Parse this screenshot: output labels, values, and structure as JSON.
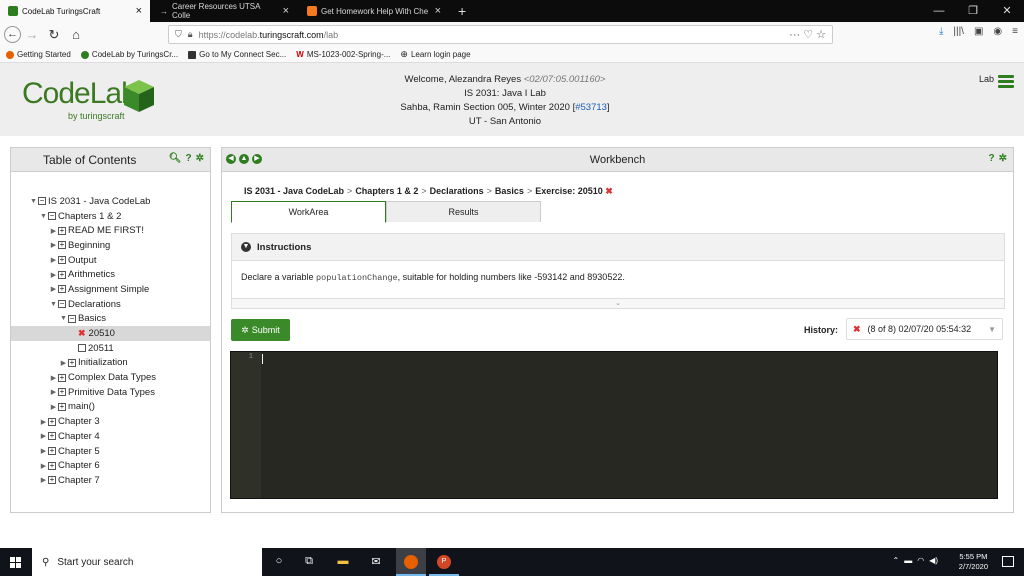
{
  "browser": {
    "tabs": [
      {
        "title": "CodeLab   TuringsCraft",
        "color": "#2e7d1e"
      },
      {
        "title": "Career Resources   UTSA Colle",
        "color": "#888888"
      },
      {
        "title": "Get Homework Help With Che",
        "color": "#f47b20"
      }
    ],
    "url_prefix": "https://codelab.",
    "url_domain": "turingscraft.com",
    "url_path": "/lab",
    "bookmarks": [
      "Getting Started",
      "CodeLab by TuringsCr...",
      "Go to My Connect Sec...",
      "MS-1023-002-Spring-...",
      "Learn login page"
    ]
  },
  "header": {
    "logo": "CodeLab",
    "logo_sub": "by turingscraft",
    "welcome": "Welcome, Alezandra Reyes",
    "welcome_id": "<02/07:05.001160>",
    "course": "IS 2031: Java I Lab",
    "section_prefix": "Sahba, Ramin  Section 005, Winter 2020  [",
    "section_id": "#53713",
    "section_suffix": "]",
    "school": "UT - San Antonio",
    "lab_link": "Lab"
  },
  "toc": {
    "title": "Table of Contents",
    "items": [
      {
        "label": "IS 2031 - Java CodeLab",
        "indent": 0,
        "tw": "▼",
        "box": "⊟"
      },
      {
        "label": "Chapters 1 & 2",
        "indent": 1,
        "tw": "▼",
        "box": "⊟"
      },
      {
        "label": "READ ME FIRST!",
        "indent": 2,
        "tw": "▶",
        "box": "⊞"
      },
      {
        "label": "Beginning",
        "indent": 2,
        "tw": "▶",
        "box": "⊞"
      },
      {
        "label": "Output",
        "indent": 2,
        "tw": "▶",
        "box": "⊞"
      },
      {
        "label": "Arithmetics",
        "indent": 2,
        "tw": "▶",
        "box": "⊞"
      },
      {
        "label": "Assignment Simple",
        "indent": 2,
        "tw": "▶",
        "box": "⊞"
      },
      {
        "label": "Declarations",
        "indent": 2,
        "tw": "▼",
        "box": "⊟"
      },
      {
        "label": "Basics",
        "indent": 3,
        "tw": "▼",
        "box": "⊟"
      },
      {
        "label": "20510",
        "indent": 4,
        "tw": "",
        "box": "",
        "status": "x",
        "selected": true
      },
      {
        "label": "20511",
        "indent": 4,
        "tw": "",
        "box": "☐"
      },
      {
        "label": "Initialization",
        "indent": 3,
        "tw": "▶",
        "box": "⊞"
      },
      {
        "label": "Complex Data Types",
        "indent": 2,
        "tw": "▶",
        "box": "⊞"
      },
      {
        "label": "Primitive Data Types",
        "indent": 2,
        "tw": "▶",
        "box": "⊞"
      },
      {
        "label": "main()",
        "indent": 2,
        "tw": "▶",
        "box": "⊞"
      },
      {
        "label": "Chapter 3",
        "indent": 1,
        "tw": "▶",
        "box": "⊞"
      },
      {
        "label": "Chapter 4",
        "indent": 1,
        "tw": "▶",
        "box": "⊞"
      },
      {
        "label": "Chapter 5",
        "indent": 1,
        "tw": "▶",
        "box": "⊞"
      },
      {
        "label": "Chapter 6",
        "indent": 1,
        "tw": "▶",
        "box": "⊞"
      },
      {
        "label": "Chapter 7",
        "indent": 1,
        "tw": "▶",
        "box": "⊞"
      }
    ]
  },
  "workbench": {
    "title": "Workbench",
    "breadcrumb": [
      "IS 2031 - Java CodeLab",
      "Chapters 1 & 2",
      "Declarations",
      "Basics"
    ],
    "exercise": "Exercise: 20510",
    "tabs": [
      "WorkArea",
      "Results"
    ],
    "instructions_title": "Instructions",
    "instr_pre": "Declare a variable ",
    "instr_code": "populationChange",
    "instr_post": ", suitable for holding numbers like -593142 and 8930522.",
    "submit": "Submit",
    "history_label": "History:",
    "history_value": "(8 of 8)  02/07/20  05:54:32",
    "line_number": "1"
  },
  "taskbar": {
    "search_placeholder": "Start your search",
    "time": "5:55 PM",
    "date": "2/7/2020"
  }
}
